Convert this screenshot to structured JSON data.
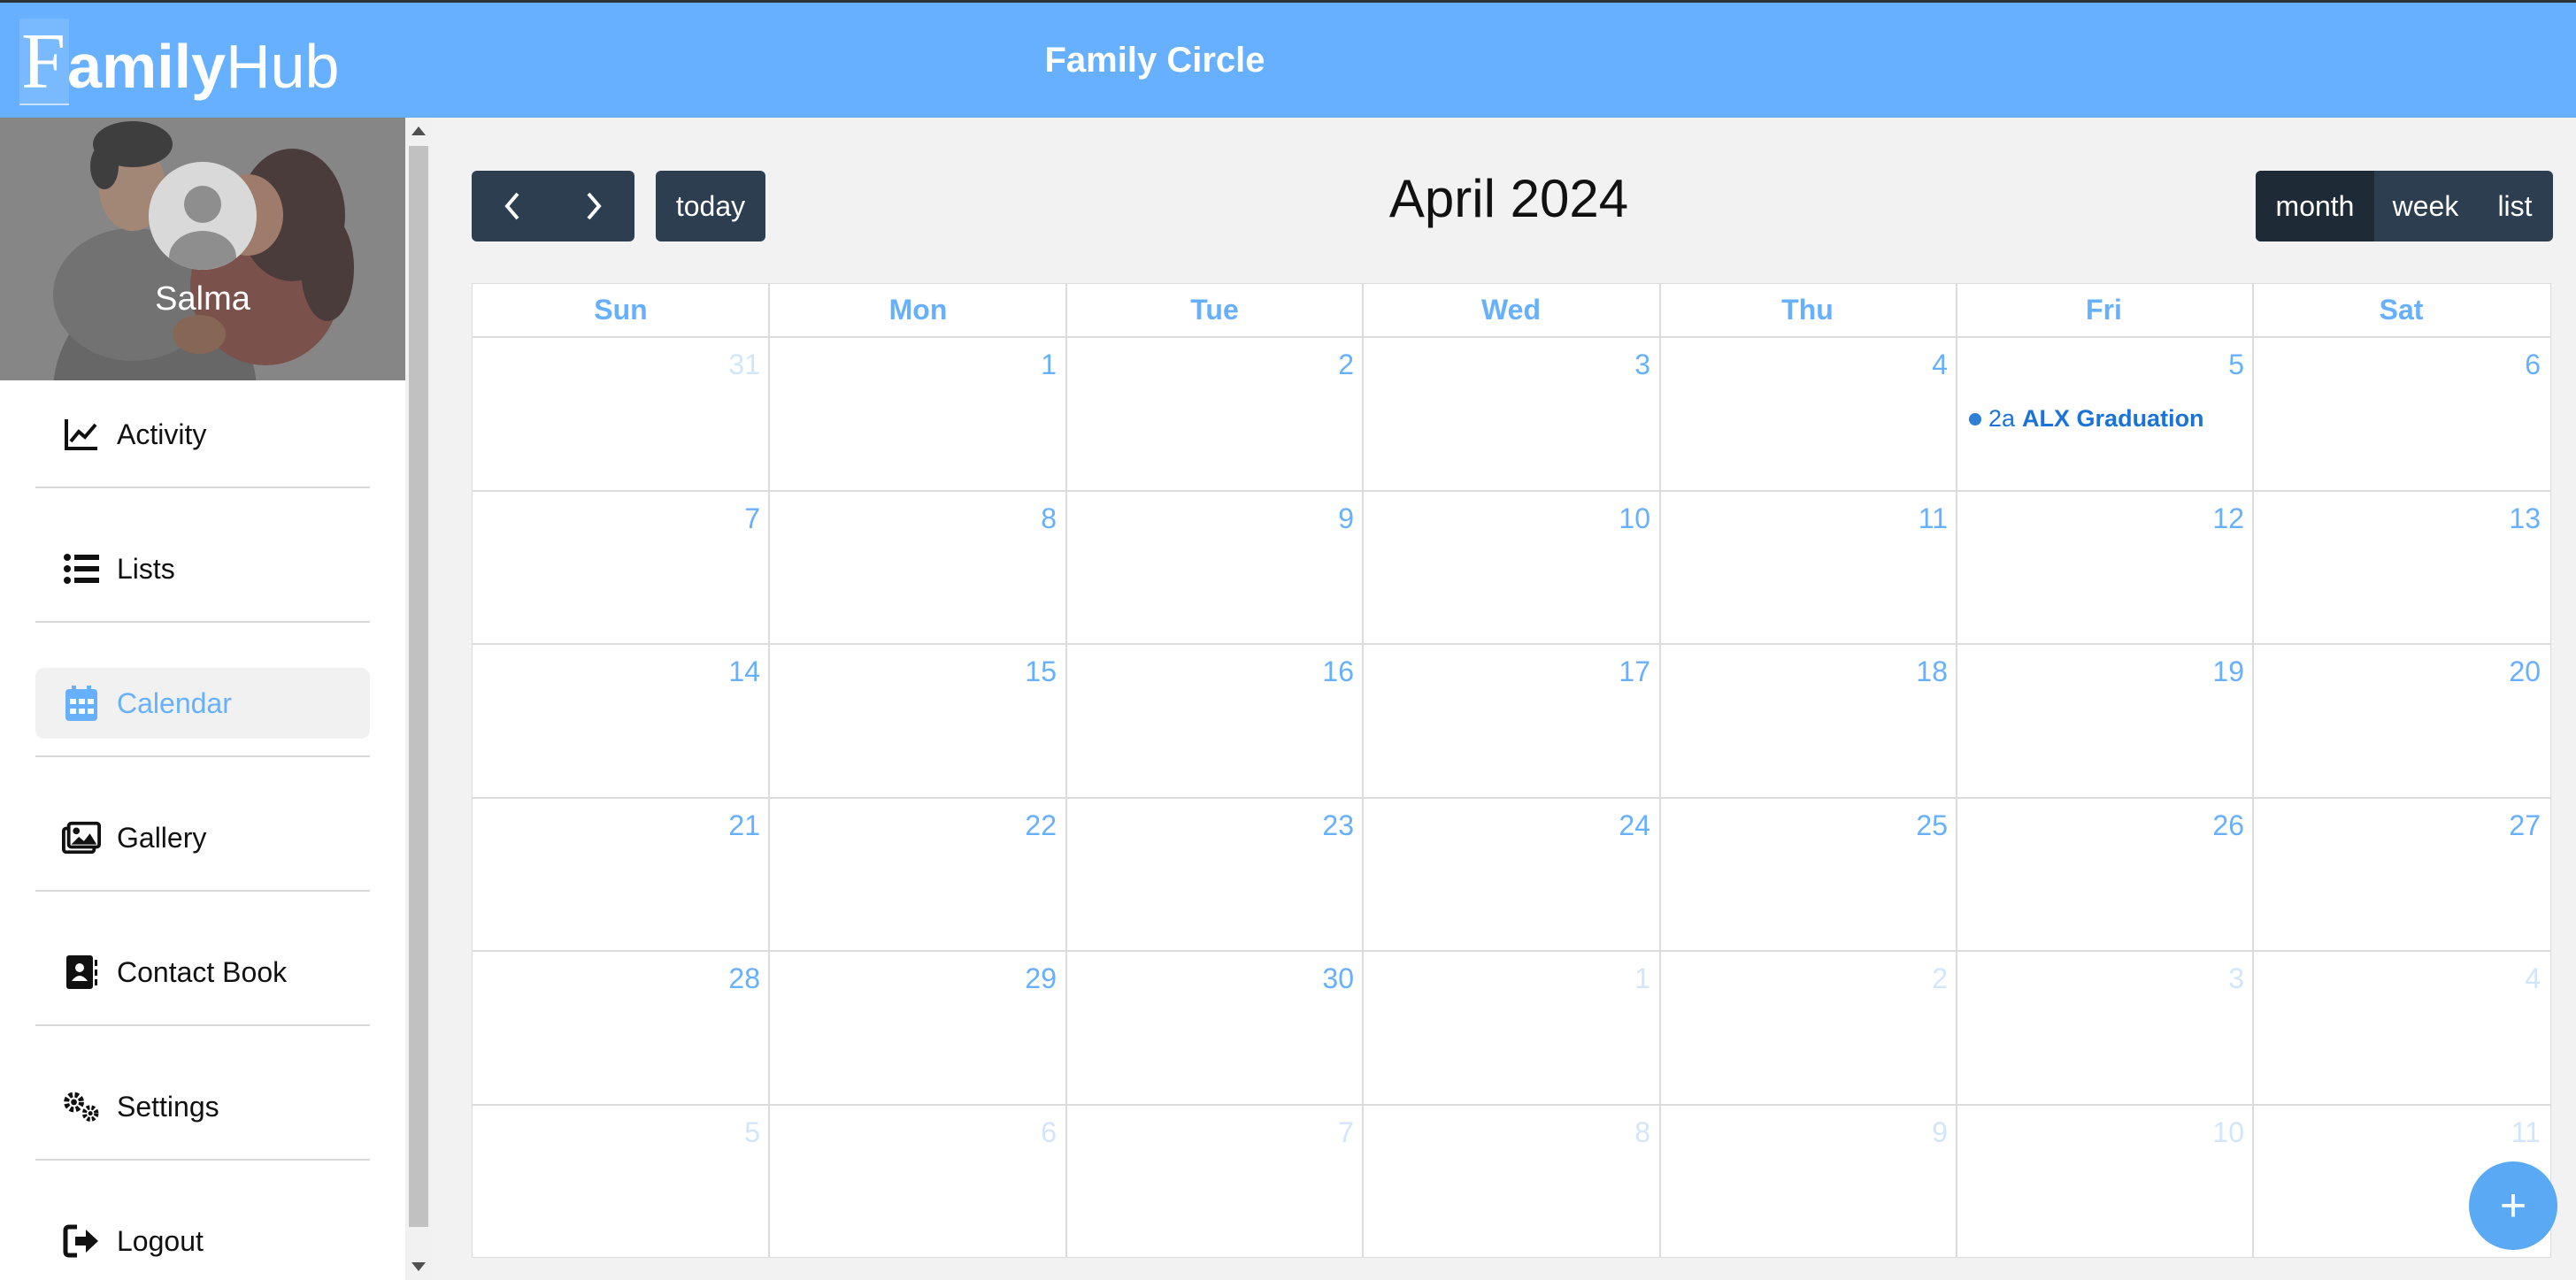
{
  "app": {
    "logo_f": "F",
    "logo_family": "amily",
    "logo_hub": "Hub",
    "title": "Family Circle"
  },
  "profile": {
    "name": "Salma"
  },
  "nav": [
    {
      "label": "Activity",
      "icon": "chart-line-icon"
    },
    {
      "label": "Lists",
      "icon": "list-icon"
    },
    {
      "label": "Calendar",
      "icon": "calendar-icon",
      "active": true
    },
    {
      "label": "Gallery",
      "icon": "images-icon"
    },
    {
      "label": "Contact Book",
      "icon": "address-book-icon"
    },
    {
      "label": "Settings",
      "icon": "gears-icon"
    },
    {
      "label": "Logout",
      "icon": "sign-out-icon"
    }
  ],
  "calendar": {
    "title": "April 2024",
    "today_label": "today",
    "view_buttons": [
      "month",
      "week",
      "list"
    ],
    "active_view": "month",
    "weekdays": [
      "Sun",
      "Mon",
      "Tue",
      "Wed",
      "Thu",
      "Fri",
      "Sat"
    ],
    "weeks": [
      [
        "31",
        "1",
        "2",
        "3",
        "4",
        "5",
        "6"
      ],
      [
        "7",
        "8",
        "9",
        "10",
        "11",
        "12",
        "13"
      ],
      [
        "14",
        "15",
        "16",
        "17",
        "18",
        "19",
        "20"
      ],
      [
        "21",
        "22",
        "23",
        "24",
        "25",
        "26",
        "27"
      ],
      [
        "28",
        "29",
        "30",
        "1",
        "2",
        "3",
        "4"
      ],
      [
        "5",
        "6",
        "7",
        "8",
        "9",
        "10",
        "11"
      ]
    ],
    "event": {
      "time": "2a",
      "title": "ALX Graduation"
    },
    "add_label": "+"
  },
  "colors": {
    "header": "#66b0ff",
    "accent": "#66b0ff",
    "button": "#2c3e50",
    "button_active": "#1e2b37",
    "event": "#1a73d9"
  }
}
